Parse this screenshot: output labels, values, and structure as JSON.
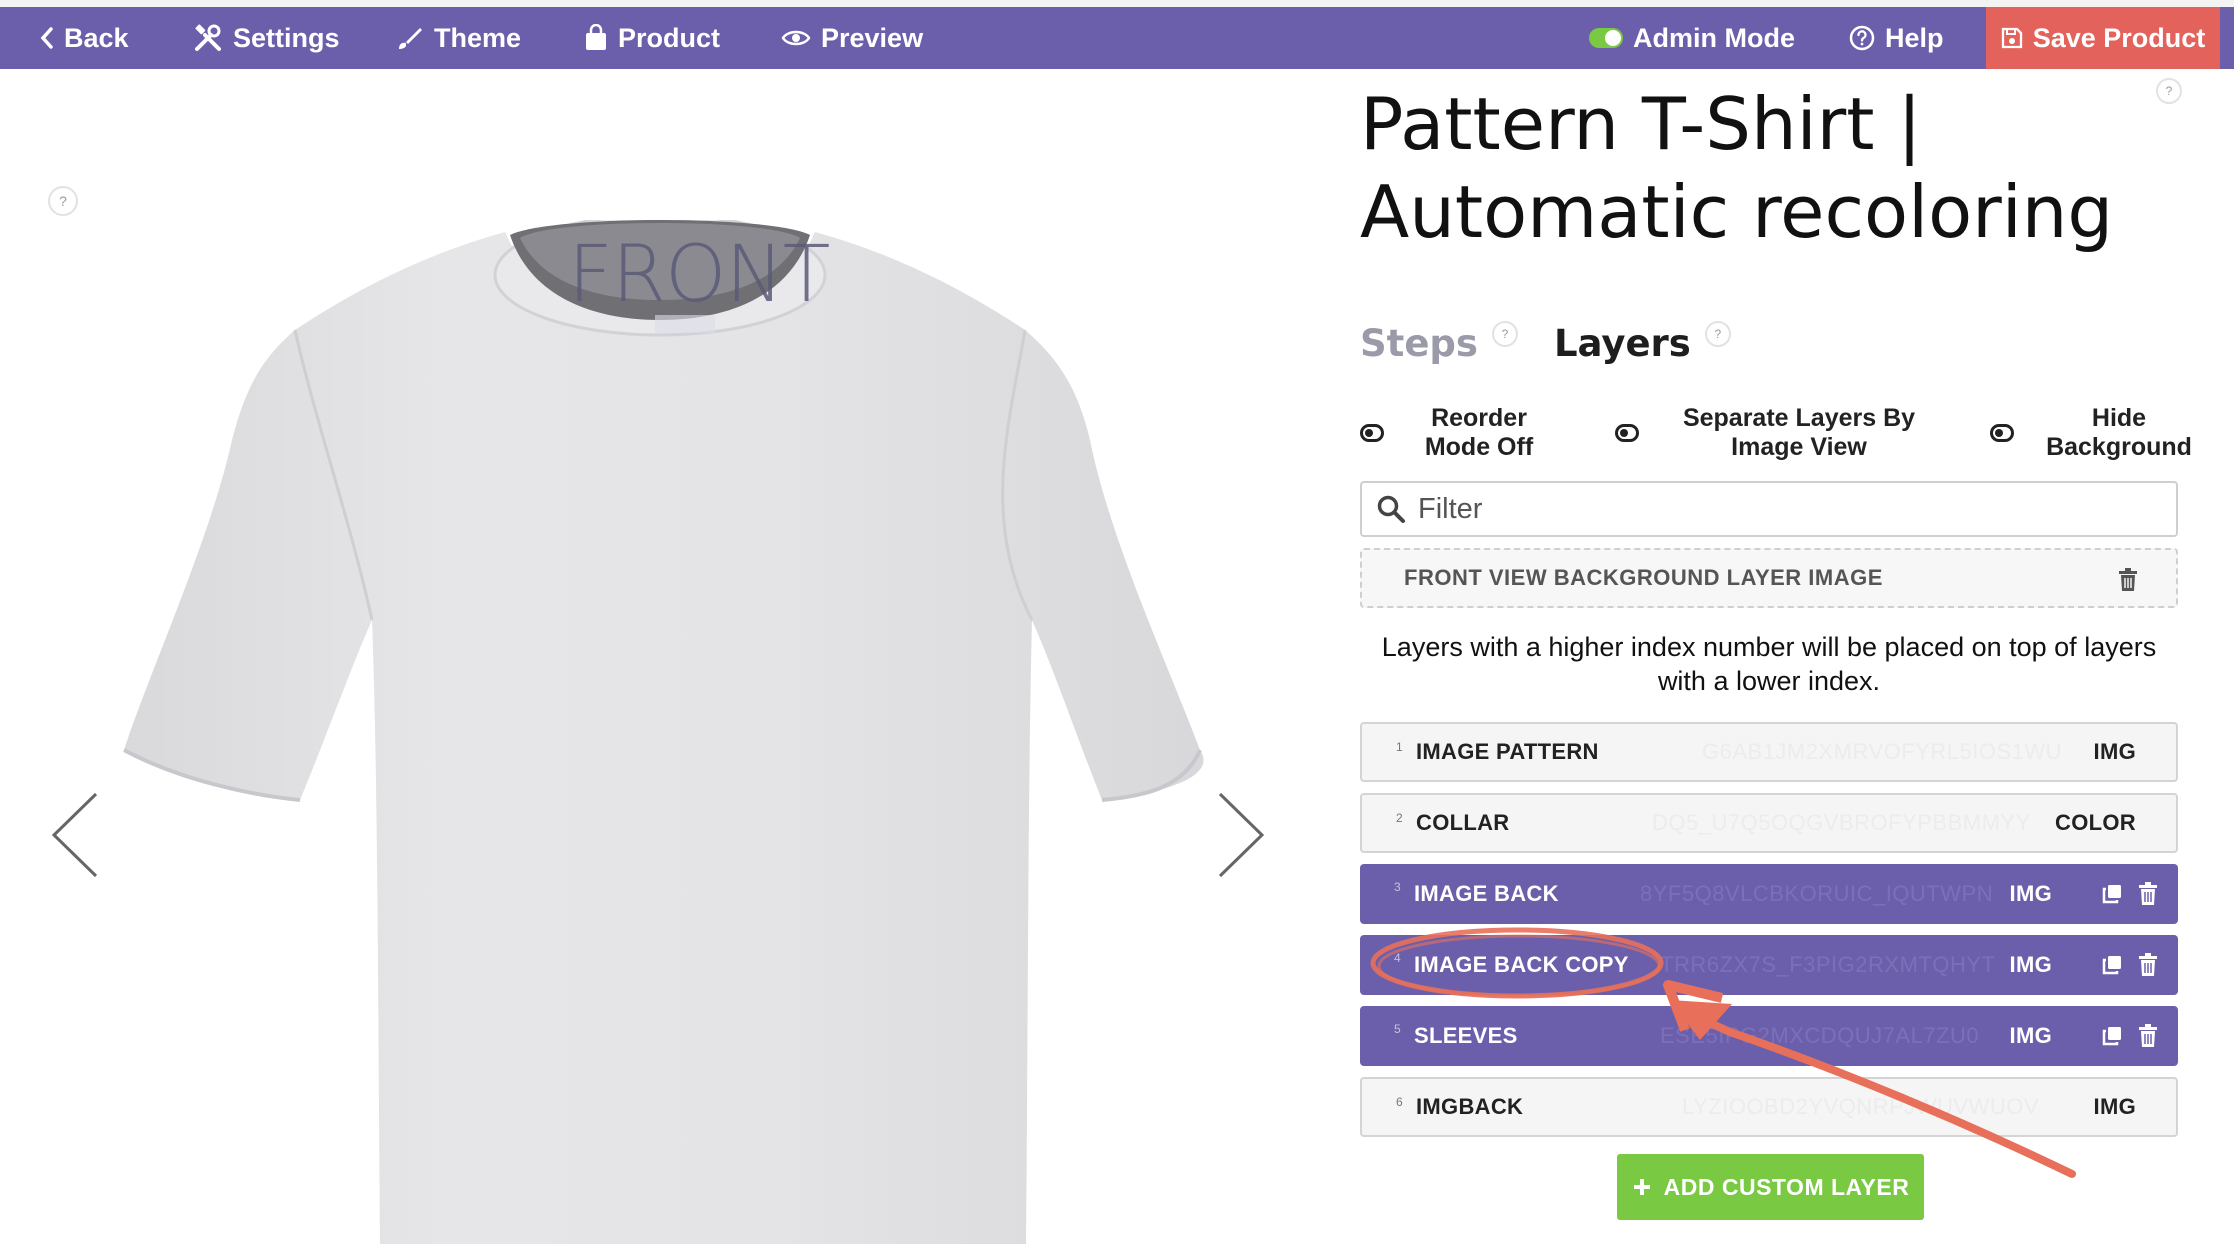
{
  "nav": {
    "back": "Back",
    "settings": "Settings",
    "theme": "Theme",
    "product": "Product",
    "preview": "Preview",
    "admin_mode": "Admin Mode",
    "help": "Help",
    "save": "Save Product"
  },
  "preview": {
    "view_label": "FRONT",
    "help": "?"
  },
  "panel": {
    "title": "Pattern T-Shirt | Automatic recoloring",
    "help": "?",
    "tabs": [
      {
        "label": "Steps",
        "help": "?"
      },
      {
        "label": "Layers",
        "help": "?"
      }
    ],
    "toggles": [
      {
        "label": "Reorder Mode Off"
      },
      {
        "label": "Separate Layers By Image View"
      },
      {
        "label": "Hide Background"
      }
    ],
    "filter_placeholder": "Filter",
    "background_layer": "FRONT VIEW BACKGROUND LAYER IMAGE",
    "info": "Layers with a higher index number will be placed on top of layers with a lower index.",
    "layers": [
      {
        "index": "1",
        "name": "IMAGE PATTERN",
        "code": "G6AB1JM2XMRVOFYRL5IOS1WU",
        "type": "IMG"
      },
      {
        "index": "2",
        "name": "COLLAR",
        "code": "DQ5_U7Q5OQGVBROFYPBBMMYY",
        "type": "COLOR"
      },
      {
        "index": "3",
        "name": "IMAGE BACK",
        "code": "8YF5Q8VLCBKORUIC_IQUTWPN",
        "type": "IMG"
      },
      {
        "index": "4",
        "name": "IMAGE BACK COPY",
        "code": "TRR6ZX7S_F3PIG2RXMTQHYT",
        "type": "IMG"
      },
      {
        "index": "5",
        "name": "SLEEVES",
        "code": "ESE5IPG2MXCDQUJ7AL7ZU0",
        "type": "IMG"
      },
      {
        "index": "6",
        "name": "IMGBACK",
        "code": "LYZIOOBD2YVQNRPJWUVWUOV",
        "type": "IMG"
      }
    ],
    "add_layer": "ADD CUSTOM LAYER"
  },
  "colors": {
    "nav_bg": "#6b5fab",
    "save_bg": "#e4625c",
    "accent_green": "#7ac943",
    "annotation": "#e8705a"
  }
}
